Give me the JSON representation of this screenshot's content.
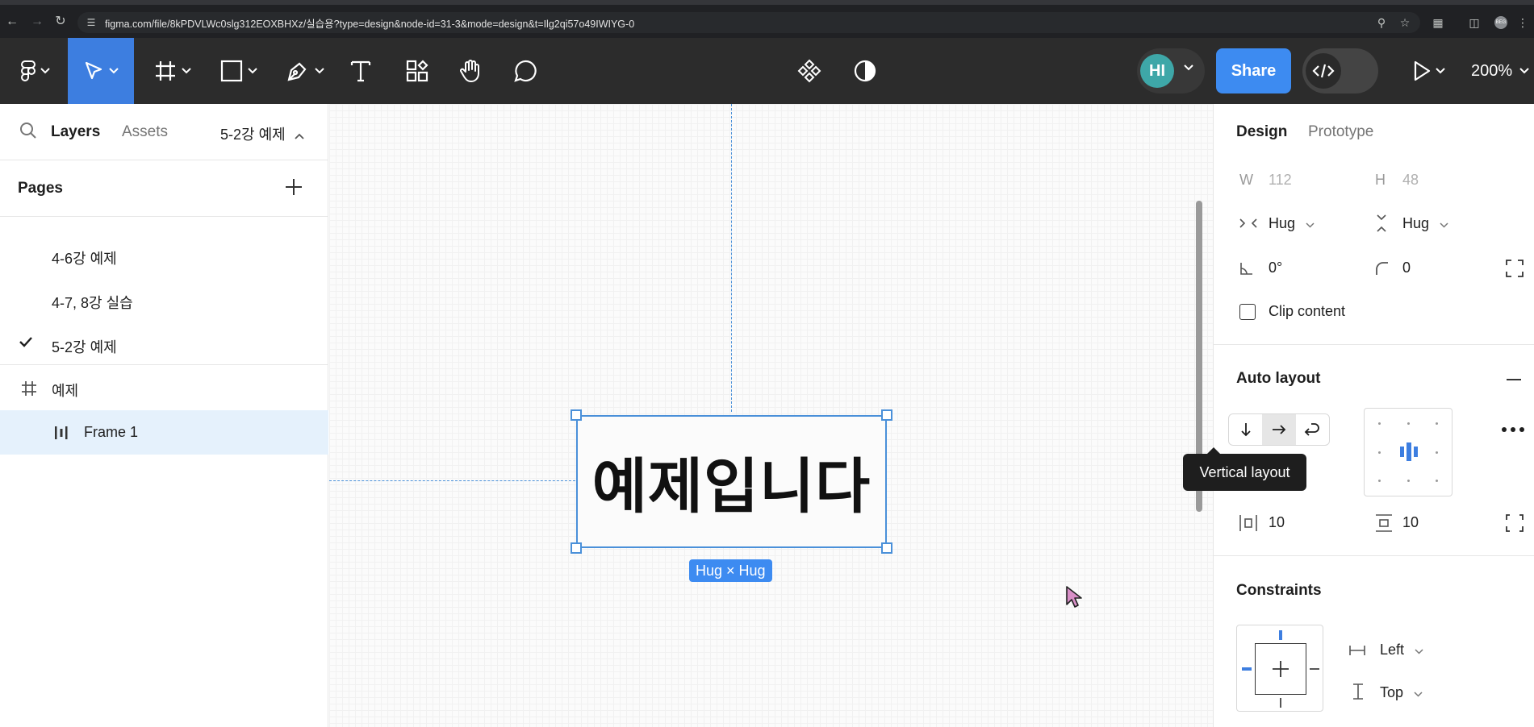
{
  "browser": {
    "url": "figma.com/file/8kPDVLWc0slg312EOXBHXz/실습용?type=design&node-id=31-3&mode=design&t=Ilg2qi57o49IWIYG-0",
    "profile_initials": "BEG"
  },
  "toolbar": {
    "avatar_initials": "HI",
    "share_label": "Share",
    "zoom_label": "200%"
  },
  "left_panel": {
    "tab_layers": "Layers",
    "tab_assets": "Assets",
    "current_page": "5-2강 예제",
    "pages_title": "Pages",
    "pages": [
      {
        "label": "4-6강 예제",
        "selected": false
      },
      {
        "label": "4-7, 8강 실습",
        "selected": false
      },
      {
        "label": "5-2강 예제",
        "selected": true
      }
    ],
    "layers": [
      {
        "label": "예제",
        "icon": "frame-icon"
      },
      {
        "label": "Frame 1",
        "icon": "autolayout-horizontal-icon"
      }
    ]
  },
  "canvas": {
    "frame_text": "예제입니다",
    "size_badge": "Hug × Hug"
  },
  "right_panel": {
    "tab_design": "Design",
    "tab_prototype": "Prototype",
    "w_label": "W",
    "w_value": "112",
    "h_label": "H",
    "h_value": "48",
    "width_mode": "Hug",
    "height_mode": "Hug",
    "rotation": "0°",
    "radius": "0",
    "clip_content_label": "Clip content",
    "auto_layout_title": "Auto layout",
    "tooltip": "Vertical layout",
    "padding_horizontal": "10",
    "padding_vertical": "10",
    "constraints_title": "Constraints",
    "constraint_horizontal": "Left",
    "constraint_vertical": "Top"
  },
  "colors": {
    "accent": "#3d8bf1",
    "selection": "#4a90d9",
    "toolbar_bg": "#2c2c2c",
    "layer_selected_bg": "#e5f1fc"
  }
}
